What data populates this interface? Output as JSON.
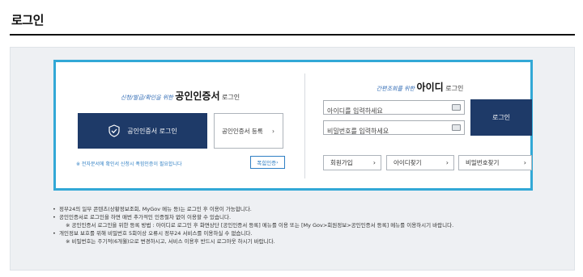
{
  "page": {
    "title": "로그인"
  },
  "cert_login": {
    "heading_pre": "신청/발급/확인을 위한",
    "heading_big": "공인인증서",
    "heading_post": "로그인",
    "login_button": "공인인증서 로그인",
    "register_button": "공인인증서 등록",
    "note": "※ 전자문서에 확인서 신청시 폭힘인증이 필요합니다",
    "joint_cert_button": "폭힘인증"
  },
  "id_login": {
    "heading_pre": "간편조회를 위한",
    "heading_big": "아이디",
    "heading_post": "로그인",
    "id_placeholder": "아이디를 입력하세요",
    "pw_placeholder": "비밀번호를 입력하세요",
    "login_button": "로그인",
    "signup_button": "회원가입",
    "find_id_button": "아이디찾기",
    "find_pw_button": "비밀번호찾기"
  },
  "notes": [
    {
      "text": "정부24의 일부 콘텐츠(상황정보조회, MyGov 메뉴 등)는 로그인 후 이용이 가능합니다."
    },
    {
      "text": "공인인증서로 로그인을 하면 매번 추가적인 인증절차 없이 이용할 수 있습니다.",
      "sub": "※ 공인인증서 로그인을 위한 등록 방법 : 아이디로 로그인 후 화면상단 [공인인증서 등록] 메뉴를 이용 또는 [My Gov>회원정보>공인인증서 등록] 메뉴를 이용하시기 바랍니다."
    },
    {
      "text": "개인정보 보호를 위해 비밀번호 5회이상 오류시 정부24 서비스를 이용하실 수 없습니다.",
      "sub": "※ 비밀번호는 주기적(6개월)으로 변경하시고, 서비스 이용후 반드시 로그아웃 하시기 바랍니다."
    }
  ]
}
